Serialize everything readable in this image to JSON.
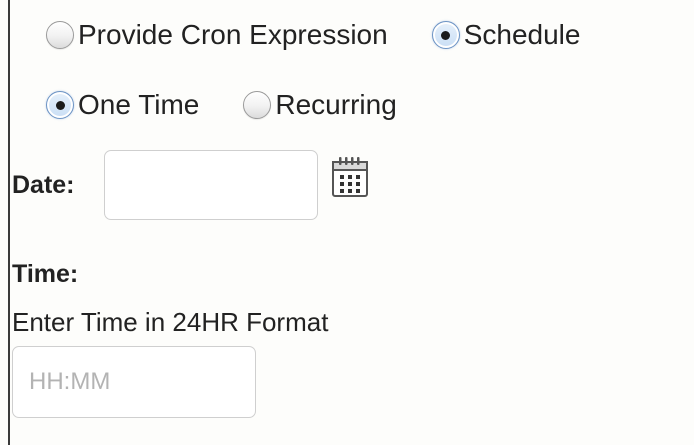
{
  "schedule_mode": {
    "options": [
      {
        "label": "Provide Cron Expression",
        "checked": false
      },
      {
        "label": "Schedule",
        "checked": true
      }
    ]
  },
  "frequency": {
    "options": [
      {
        "label": "One Time",
        "checked": true
      },
      {
        "label": "Recurring",
        "checked": false
      }
    ]
  },
  "date": {
    "label": "Date:",
    "value": "",
    "calendar_icon": "calendar-icon"
  },
  "time": {
    "label": "Time:",
    "helper_text": "Enter Time in 24HR Format",
    "value": "",
    "placeholder": "HH:MM"
  }
}
